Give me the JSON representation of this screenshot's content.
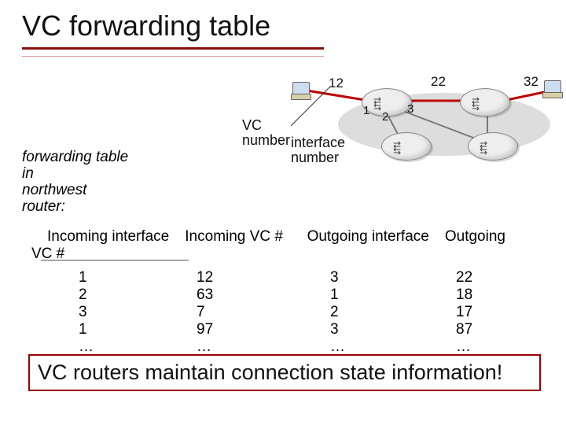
{
  "title": "VC forwarding table",
  "diagram": {
    "vc_number_label_line1": "VC",
    "vc_number_label_line2": "number",
    "interface_number_label_line1": "interface",
    "interface_number_label_line2": "number",
    "link_labels": {
      "left": "12",
      "mid": "22",
      "right": "32"
    },
    "port_labels": {
      "p1": "1",
      "p2": "2",
      "p3": "3"
    }
  },
  "caption_line1": "forwarding table",
  "caption_line2": "in",
  "caption_line3": "northwest",
  "caption_line4": "router:",
  "headers": {
    "in_if": "Incoming interface",
    "in_vc": "Incoming VC #",
    "out_if": "Outgoing interface",
    "out_vc_line1": "Outgoing",
    "out_vc_line2": "VC #"
  },
  "rows": [
    {
      "in_if": "1",
      "in_vc": "12",
      "out_if": "3",
      "out_vc": "22"
    },
    {
      "in_if": "2",
      "in_vc": "63",
      "out_if": "1",
      "out_vc": "18"
    },
    {
      "in_if": "3",
      "in_vc": "7",
      "out_if": "2",
      "out_vc": "17"
    },
    {
      "in_if": "1",
      "in_vc": "97",
      "out_if": "3",
      "out_vc": "87"
    },
    {
      "in_if": "…",
      "in_vc": "…",
      "out_if": "…",
      "out_vc": "…"
    }
  ],
  "callout": "VC routers maintain connection state information!",
  "chart_data": {
    "type": "table",
    "title": "VC forwarding table (northwest router)",
    "columns": [
      "Incoming interface",
      "Incoming VC #",
      "Outgoing interface",
      "Outgoing VC #"
    ],
    "rows": [
      [
        "1",
        "12",
        "3",
        "22"
      ],
      [
        "2",
        "63",
        "1",
        "18"
      ],
      [
        "3",
        "7",
        "2",
        "17"
      ],
      [
        "1",
        "97",
        "3",
        "87"
      ],
      [
        "…",
        "…",
        "…",
        "…"
      ]
    ],
    "diagram_edges": [
      {
        "from": "PC-left",
        "to": "Router-NW",
        "vc": 12
      },
      {
        "from": "Router-NW",
        "to": "Router-NE",
        "vc": 22
      },
      {
        "from": "Router-NE",
        "to": "PC-right",
        "vc": 32
      }
    ],
    "router_nw_ports": {
      "1": "left-host",
      "2": "to-SW-router",
      "3": "to-NE-router"
    }
  }
}
